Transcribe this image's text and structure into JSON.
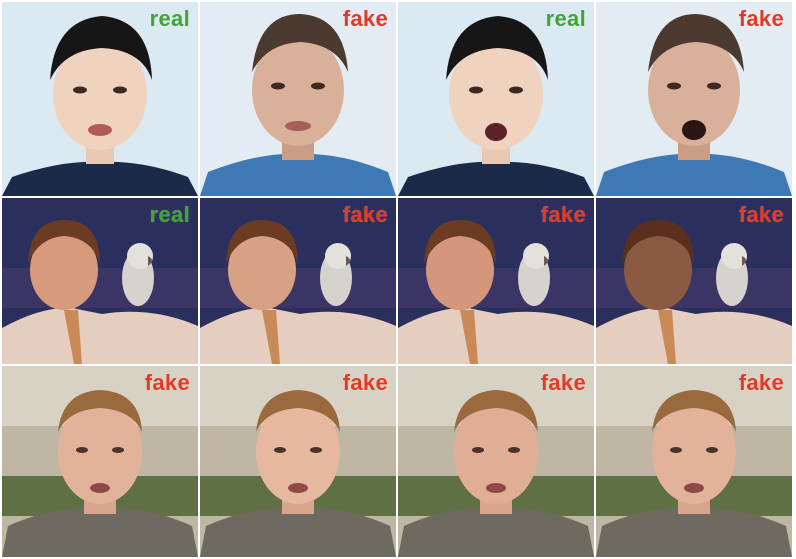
{
  "colors": {
    "real": "#3fa535",
    "fake": "#e23b25"
  },
  "rows": [
    {
      "name": "row-1",
      "tiles": [
        {
          "label": "real",
          "label_kind": "real",
          "scene": "man-a"
        },
        {
          "label": "fake",
          "label_kind": "fake",
          "scene": "man-b"
        },
        {
          "label": "real",
          "label_kind": "real",
          "scene": "man-a"
        },
        {
          "label": "fake",
          "label_kind": "fake",
          "scene": "man-b"
        }
      ]
    },
    {
      "name": "row-2",
      "tiles": [
        {
          "label": "real",
          "label_kind": "real",
          "scene": "anchor"
        },
        {
          "label": "fake",
          "label_kind": "fake",
          "scene": "anchor"
        },
        {
          "label": "fake",
          "label_kind": "fake",
          "scene": "anchor"
        },
        {
          "label": "fake",
          "label_kind": "fake",
          "scene": "anchor"
        }
      ]
    },
    {
      "name": "row-3",
      "tiles": [
        {
          "label": "fake",
          "label_kind": "fake",
          "scene": "man-c"
        },
        {
          "label": "fake",
          "label_kind": "fake",
          "scene": "man-c"
        },
        {
          "label": "fake",
          "label_kind": "fake",
          "scene": "man-c"
        },
        {
          "label": "fake",
          "label_kind": "fake",
          "scene": "man-c"
        }
      ]
    }
  ]
}
